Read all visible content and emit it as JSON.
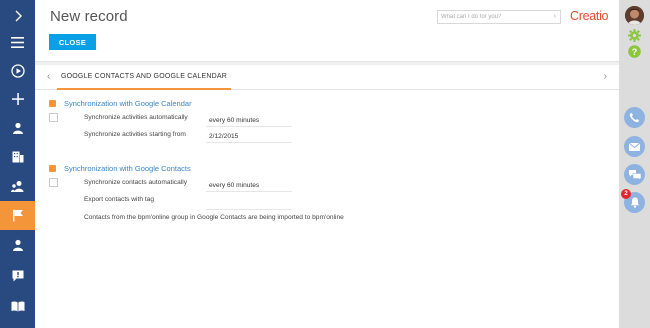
{
  "header": {
    "title": "New record",
    "close_label": "CLOSE",
    "search_placeholder": "What can I do for you?",
    "logo": "Creatio"
  },
  "tabs": {
    "active": "GOOGLE CONTACTS AND GOOGLE CALENDAR"
  },
  "calendar": {
    "title": "Synchronization with Google Calendar",
    "sync_auto_label": "Synchronize activities automatically",
    "sync_auto_value": "every 60 minutes",
    "sync_start_label": "Synchronize activities starting from",
    "sync_start_value": "2/12/2015"
  },
  "contacts": {
    "title": "Synchronization with Google Contacts",
    "sync_auto_label": "Synchronize contacts automatically",
    "sync_auto_value": "every 60 minutes",
    "export_tag_label": "Export contacts with tag",
    "info": "Contacts from the bpm'online group in Google Contacts are being imported to bpm'online"
  },
  "right_bar": {
    "notification_count": "2"
  },
  "icons": {
    "left": [
      "chevron-right-icon",
      "menu-icon",
      "play-icon",
      "plus-icon",
      "contact-icon",
      "account-icon",
      "users-icon",
      "flag-icon",
      "contact-icon",
      "chat-icon",
      "book-icon"
    ],
    "right": [
      "gear-icon",
      "help-icon",
      "phone-icon",
      "email-icon",
      "messages-icon",
      "bell-icon"
    ]
  },
  "colors": {
    "sidebar": "#294a80",
    "active_item": "#f5953a",
    "close_button": "#0aa0e6",
    "logo": "#e84b2f",
    "section_title": "#3a86c6"
  }
}
